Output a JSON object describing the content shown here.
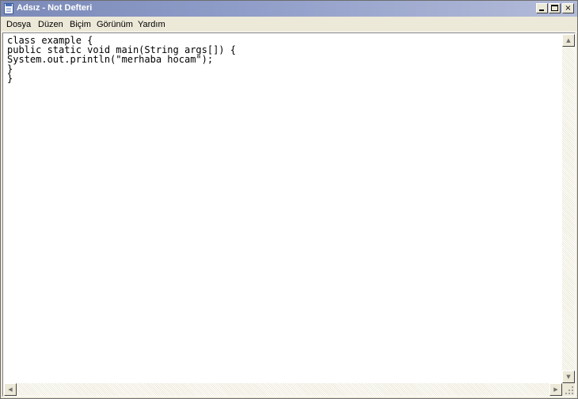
{
  "window": {
    "title": "Adsız - Not Defteri",
    "controls": {
      "minimize_icon": "minimize-icon",
      "maximize_icon": "maximize-icon",
      "close_label": "×"
    }
  },
  "menubar": {
    "items": [
      {
        "label": "Dosya"
      },
      {
        "label": "Düzen"
      },
      {
        "label": "Biçim"
      },
      {
        "label": "Görünüm"
      },
      {
        "label": "Yardım"
      }
    ]
  },
  "editor": {
    "lines": [
      "class example {",
      "public static void main(String args[]) {",
      "System.out.println(\"merhaba hocam\");",
      "}",
      "}"
    ]
  },
  "scrollbars": {
    "up_arrow": "▲",
    "down_arrow": "▼",
    "left_arrow": "◀",
    "right_arrow": "▶"
  },
  "colors": {
    "titlebar_inactive_start": "#7b8ab8",
    "titlebar_inactive_end": "#b3bbd8",
    "chrome": "#ece9d8",
    "editor_background": "#ffffff"
  }
}
